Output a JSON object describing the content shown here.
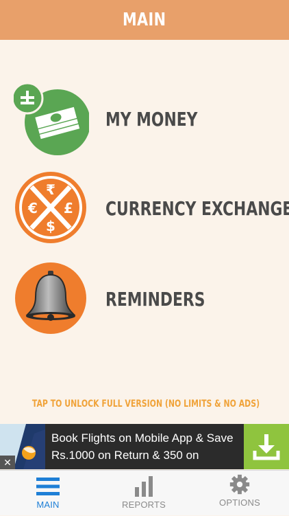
{
  "header": {
    "title": "MAIN"
  },
  "menu": {
    "items": [
      {
        "label": "MY MONEY",
        "icon": "money-stack-icon"
      },
      {
        "label": "CURRENCY EXCHANGE",
        "icon": "currency-exchange-icon"
      },
      {
        "label": "REMINDERS",
        "icon": "bell-icon"
      }
    ],
    "currency_symbols": {
      "top": "₹",
      "left": "€",
      "right": "£",
      "bottom": "$"
    }
  },
  "unlock_text": "TAP TO UNLOCK FULL VERSION (NO LIMITS & NO ADS)",
  "ad": {
    "line1": "Book Flights on Mobile App & Save",
    "line2": "Rs.1000 on Return & 350 on",
    "close_symbol": "✕"
  },
  "tabs": [
    {
      "label": "MAIN",
      "icon": "hamburger-icon",
      "active": true
    },
    {
      "label": "REPORTS",
      "icon": "bar-chart-icon",
      "active": false
    },
    {
      "label": "OPTIONS",
      "icon": "gear-icon",
      "active": false
    }
  ],
  "colors": {
    "header": "#e8a06a",
    "background": "#fbf3ea",
    "money_green": "#5aa653",
    "exchange_orange": "#ef7d2d",
    "unlock_text": "#f0a33a",
    "ad_download": "#8fc43e",
    "tab_active": "#1e7fd6"
  }
}
